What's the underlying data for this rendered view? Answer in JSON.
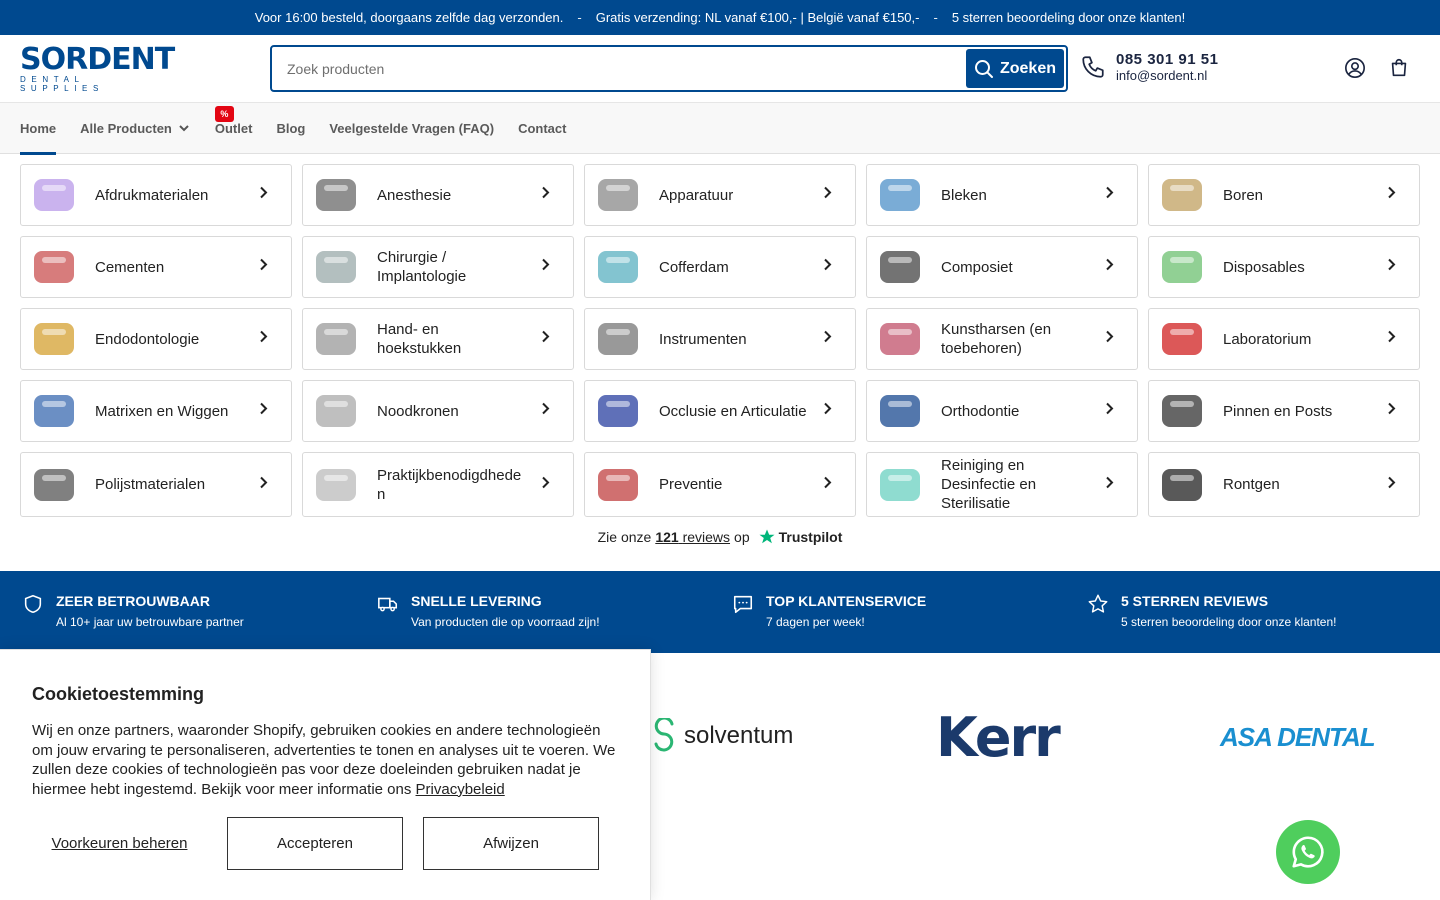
{
  "topbar": {
    "msg1": "Voor 16:00 besteld, doorgaans zelfde dag verzonden.",
    "sep": "-",
    "msg2": "Gratis verzending: NL vanaf €100,- | België vanaf €150,-",
    "msg3": "5 sterren beoordeling door onze klanten!"
  },
  "header": {
    "logo_word": "SORDENT",
    "logo_sub": "DENTAL SUPPLIES",
    "search_placeholder": "Zoek producten",
    "search_button": "Zoeken",
    "phone": "085 301 91 51",
    "email": "info@sordent.nl"
  },
  "nav": {
    "items": [
      {
        "label": "Home",
        "active": true
      },
      {
        "label": "Alle Producten"
      },
      {
        "label": "Outlet",
        "badge": "%"
      },
      {
        "label": "Blog"
      },
      {
        "label": "Veelgestelde Vragen (FAQ)"
      },
      {
        "label": "Contact"
      }
    ]
  },
  "categories": [
    "Afdrukmaterialen",
    "Anesthesie",
    "Apparatuur",
    "Bleken",
    "Boren",
    "Cementen",
    "Chirurgie / Implantologie",
    "Cofferdam",
    "Composiet",
    "Disposables",
    "Endodontologie",
    "Hand- en hoekstukken",
    "Instrumenten",
    "Kunstharsen (en toebehoren)",
    "Laboratorium",
    "Matrixen en Wiggen",
    "Noodkronen",
    "Occlusie en Articulatie",
    "Orthodontie",
    "Pinnen en Posts",
    "Polijstmaterialen",
    "Praktijkbenodigdheden",
    "Preventie",
    "Reiniging en Desinfectie en Sterilisatie",
    "Rontgen"
  ],
  "trustpilot": {
    "pre": "Zie onze",
    "count": "121",
    "reviews": "reviews",
    "post": "op",
    "brand": "Trustpilot"
  },
  "usps": [
    {
      "title": "ZEER BETROUWBAAR",
      "desc": "Al 10+ jaar uw betrouwbare partner",
      "icon": "shield-icon"
    },
    {
      "title": "SNELLE LEVERING",
      "desc": "Van producten die op voorraad zijn!",
      "icon": "truck-icon"
    },
    {
      "title": "TOP KLANTENSERVICE",
      "desc": "7 dagen per week!",
      "icon": "chat-icon"
    },
    {
      "title": "5 STERREN REVIEWS",
      "desc": "5 sterren beoordeling door onze klanten!",
      "icon": "star-icon"
    }
  ],
  "brands": [
    "solventum",
    "Kerr",
    "ASA DENTAL"
  ],
  "cookie": {
    "title": "Cookietoestemming",
    "text": "Wij en onze partners, waaronder Shopify, gebruiken cookies en andere technologieën om jouw ervaring te personaliseren, advertenties te tonen en analyses uit te voeren. We zullen deze cookies of technologieën pas voor deze doeleinden gebruiken nadat je hiermee hebt ingestemd. Bekijk voor meer informatie ons",
    "link": "Privacybeleid",
    "prefs": "Voorkeuren beheren",
    "accept": "Accepteren",
    "decline": "Afwijzen"
  },
  "colors": {
    "brand": "#00498f",
    "badge": "#e30613",
    "whatsapp": "#4fce5d",
    "trustpilot": "#00b67a"
  }
}
